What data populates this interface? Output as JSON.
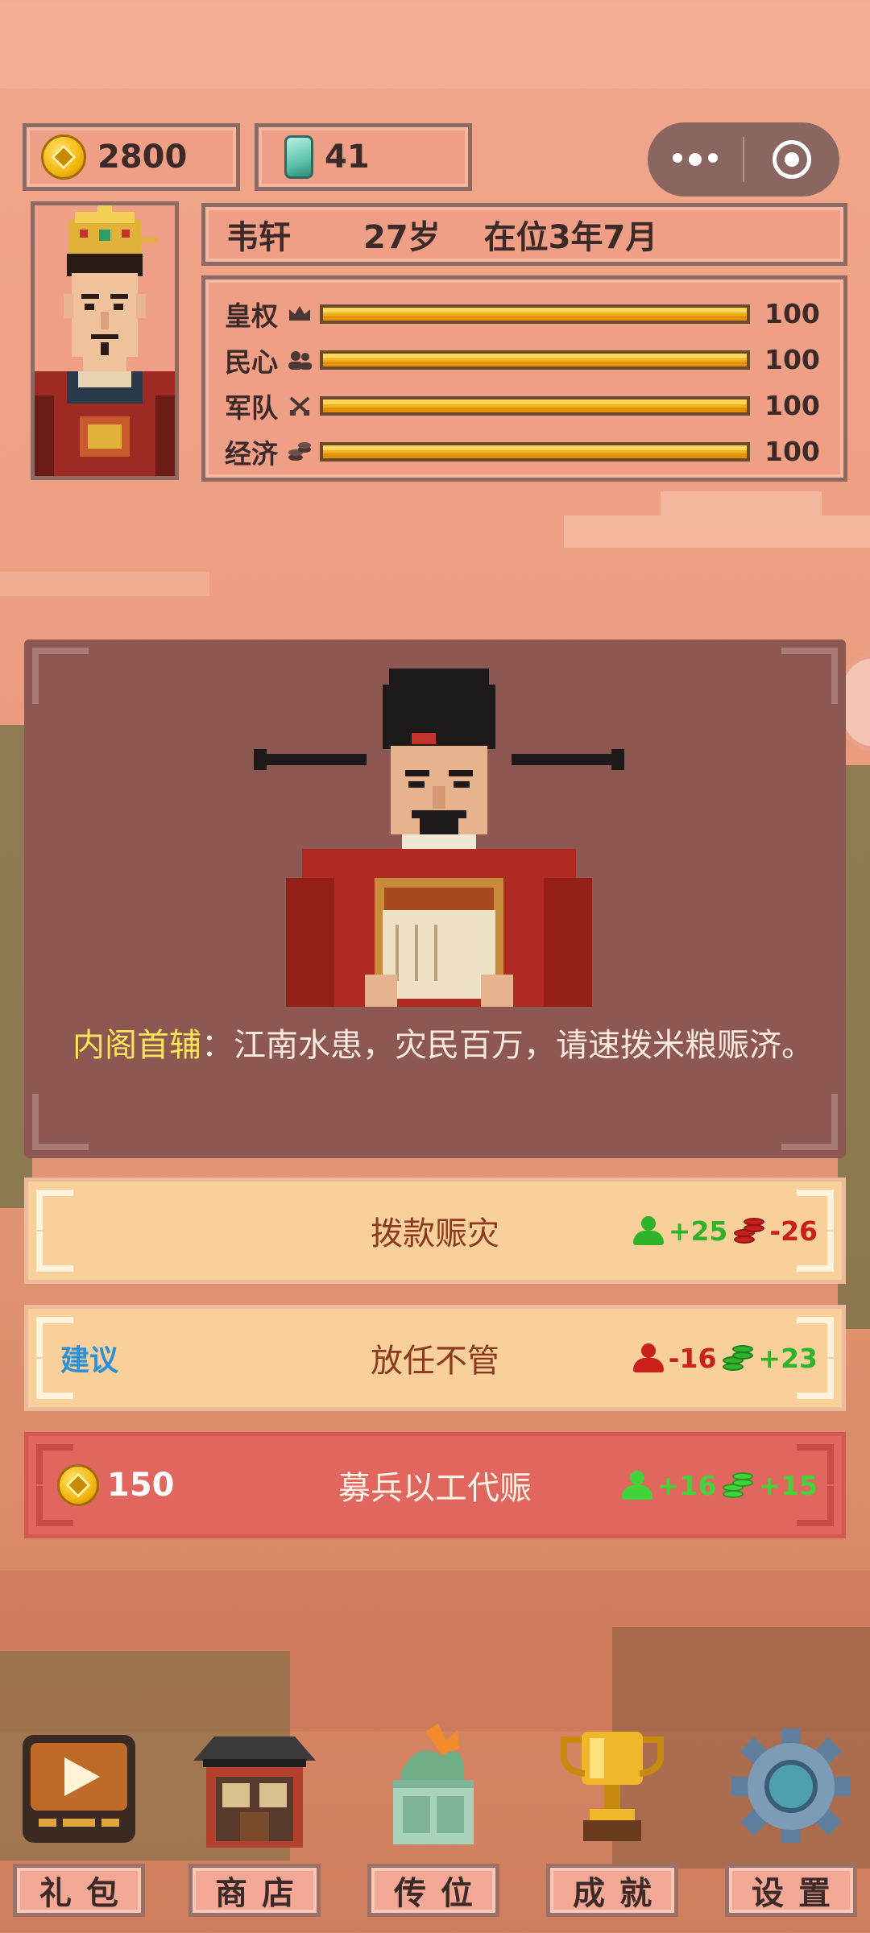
{
  "resources": {
    "gold": "2800",
    "jade": "41"
  },
  "capsule": {
    "more_icon": "more-dots-icon",
    "close_icon": "target-close-icon"
  },
  "emperor": {
    "name": "韦轩",
    "age": "27岁",
    "reign": "在位3年7月"
  },
  "stats": [
    {
      "label": "皇权",
      "icon": "crown-icon",
      "value": "100",
      "level": 1.0
    },
    {
      "label": "民心",
      "icon": "people-icon",
      "value": "100",
      "level": 1.0
    },
    {
      "label": "军队",
      "icon": "swords-icon",
      "value": "100",
      "level": 1.0
    },
    {
      "label": "经济",
      "icon": "coins-icon",
      "value": "100",
      "level": 1.0
    }
  ],
  "event": {
    "speaker": "内阁首辅",
    "separator": "：",
    "text": "江南水患，灾民百万，请速拨米粮赈济。"
  },
  "choices": [
    {
      "label": "拨款赈灾",
      "effects": [
        {
          "icon": "people-icon",
          "value": "+25",
          "type": "positive"
        },
        {
          "icon": "coins-icon",
          "value": "-26",
          "type": "negative"
        }
      ]
    },
    {
      "advice": "建议",
      "label": "放任不管",
      "effects": [
        {
          "icon": "people-icon",
          "value": "-16",
          "type": "negative"
        },
        {
          "icon": "coins-icon",
          "value": "+23",
          "type": "positive"
        }
      ]
    },
    {
      "cost": "150",
      "label": "募兵以工代赈",
      "effects": [
        {
          "icon": "people-icon",
          "value": "+16",
          "type": "positive"
        },
        {
          "icon": "coins-icon",
          "value": "+15",
          "type": "positive"
        }
      ]
    }
  ],
  "nav": [
    {
      "label": "礼包",
      "icon": "video-play-icon"
    },
    {
      "label": "商店",
      "icon": "shop-building-icon"
    },
    {
      "label": "传位",
      "icon": "jade-seal-icon"
    },
    {
      "label": "成就",
      "icon": "trophy-icon"
    },
    {
      "label": "设置",
      "icon": "gear-icon"
    }
  ],
  "colors": {
    "background": "#eea083",
    "card": "#8d5852",
    "bar": "#f3b01a",
    "positive": "#2fb32b",
    "negative": "#c9201c",
    "advice": "#2d8fd6",
    "speaker": "#f9e45a"
  }
}
